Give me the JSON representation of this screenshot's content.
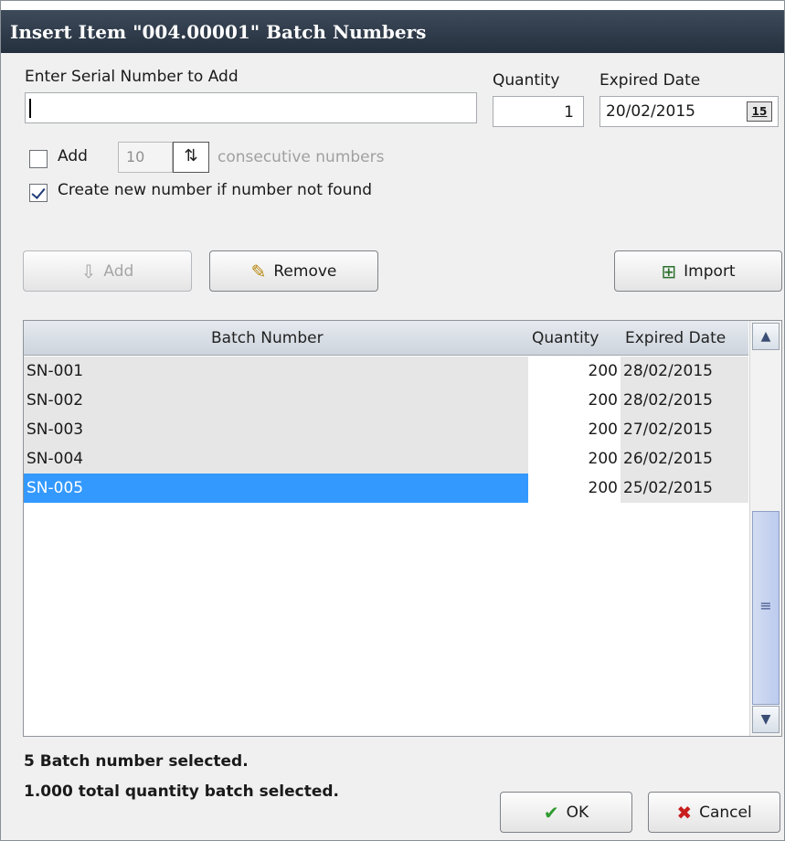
{
  "window": {
    "title": "Insert Item \"004.00001\" Batch Numbers"
  },
  "entry": {
    "serial_label": "Enter Serial Number to Add",
    "serial_value": "",
    "quantity_label": "Quantity",
    "quantity_value": "1",
    "expired_label": "Expired Date",
    "expired_value": "20/02/2015",
    "calendar_glyph": "15"
  },
  "options": {
    "add_label": "Add",
    "add_checked": false,
    "consecutive_count": "10",
    "consecutive_label": "consecutive numbers",
    "create_label": "Create new number if number not found",
    "create_checked": true
  },
  "toolbar": {
    "add_label": "Add",
    "remove_label": "Remove",
    "import_label": "Import"
  },
  "grid": {
    "columns": [
      "Batch Number",
      "Quantity",
      "Expired Date"
    ],
    "rows": [
      {
        "batch": "SN-001",
        "quantity": "200",
        "expired": "28/02/2015"
      },
      {
        "batch": "SN-002",
        "quantity": "200",
        "expired": "28/02/2015"
      },
      {
        "batch": "SN-003",
        "quantity": "200",
        "expired": "27/02/2015"
      },
      {
        "batch": "SN-004",
        "quantity": "200",
        "expired": "26/02/2015"
      },
      {
        "batch": "SN-005",
        "quantity": "200",
        "expired": "25/02/2015",
        "selected": true
      }
    ]
  },
  "status": {
    "line1": "5 Batch number selected.",
    "line2": "1.000 total quantity batch selected."
  },
  "footer": {
    "ok_label": "OK",
    "cancel_label": "Cancel"
  },
  "icons": {
    "add": "arrow-down-outline-icon",
    "remove": "eraser-icon",
    "import": "import-icon",
    "ok": "checkmark-icon",
    "cancel": "x-icon",
    "calendar": "calendar-icon",
    "spin": "spin-arrows-icon"
  },
  "colors": {
    "titlebar": "#2f3b4a",
    "selection": "#3399ff",
    "ok_check": "#2e9b2e",
    "cancel_x": "#c81e1e"
  }
}
